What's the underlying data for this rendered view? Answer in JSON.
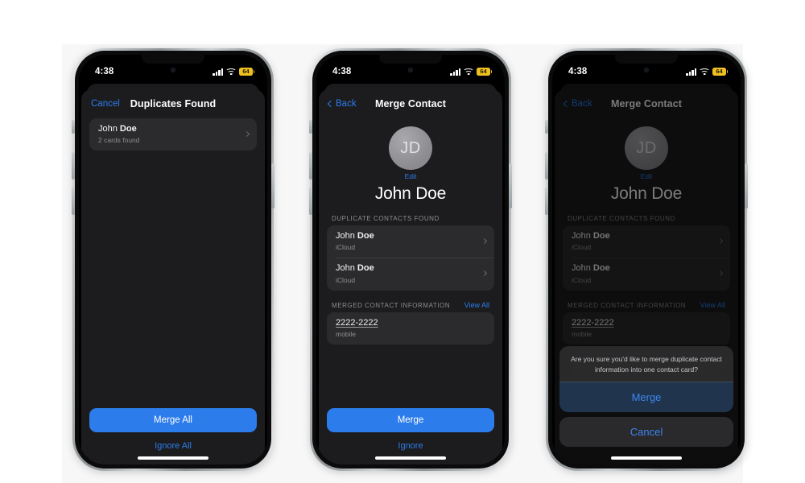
{
  "statusbar": {
    "time": "4:38",
    "signal_icon": "cellular-signal-icon",
    "wifi_icon": "wifi-icon",
    "battery_icon": "battery-low-power-icon",
    "battery_level": "64"
  },
  "accent_color": "#2c7ceb",
  "phone1": {
    "nav": {
      "left_label": "Cancel",
      "title": "Duplicates Found"
    },
    "list": [
      {
        "title_first": "John ",
        "title_last": "Doe",
        "subtitle": "2 cards found"
      }
    ],
    "primary_button": "Merge All",
    "secondary_button": "Ignore All"
  },
  "phone2": {
    "nav": {
      "back_label": "Back",
      "title": "Merge Contact"
    },
    "contact": {
      "initials": "JD",
      "edit_label": "Edit",
      "name": "John Doe"
    },
    "duplicates_section": {
      "header": "DUPLICATE CONTACTS FOUND",
      "rows": [
        {
          "title_first": "John ",
          "title_last": "Doe",
          "subtitle": "iCloud"
        },
        {
          "title_first": "John ",
          "title_last": "Doe",
          "subtitle": "iCloud"
        }
      ]
    },
    "merged_section": {
      "header": "MERGED CONTACT INFORMATION",
      "action": "View All",
      "rows": [
        {
          "value": "2222-2222",
          "label": "mobile"
        }
      ]
    },
    "primary_button": "Merge",
    "secondary_button": "Ignore"
  },
  "phone3": {
    "nav": {
      "back_label": "Back",
      "title": "Merge Contact"
    },
    "contact": {
      "initials": "JD",
      "edit_label": "Edit",
      "name": "John Doe"
    },
    "duplicates_section": {
      "header": "DUPLICATE CONTACTS FOUND",
      "rows": [
        {
          "title_first": "John ",
          "title_last": "Doe",
          "subtitle": "iCloud"
        },
        {
          "title_first": "John ",
          "title_last": "Doe",
          "subtitle": "iCloud"
        }
      ]
    },
    "merged_section": {
      "header": "MERGED CONTACT INFORMATION",
      "action": "View All",
      "rows": [
        {
          "value": "2222-2222",
          "label": "mobile"
        }
      ]
    },
    "alert": {
      "message": "Are you sure you'd like to merge duplicate contact information into one contact card?",
      "confirm_label": "Merge",
      "cancel_label": "Cancel"
    }
  }
}
